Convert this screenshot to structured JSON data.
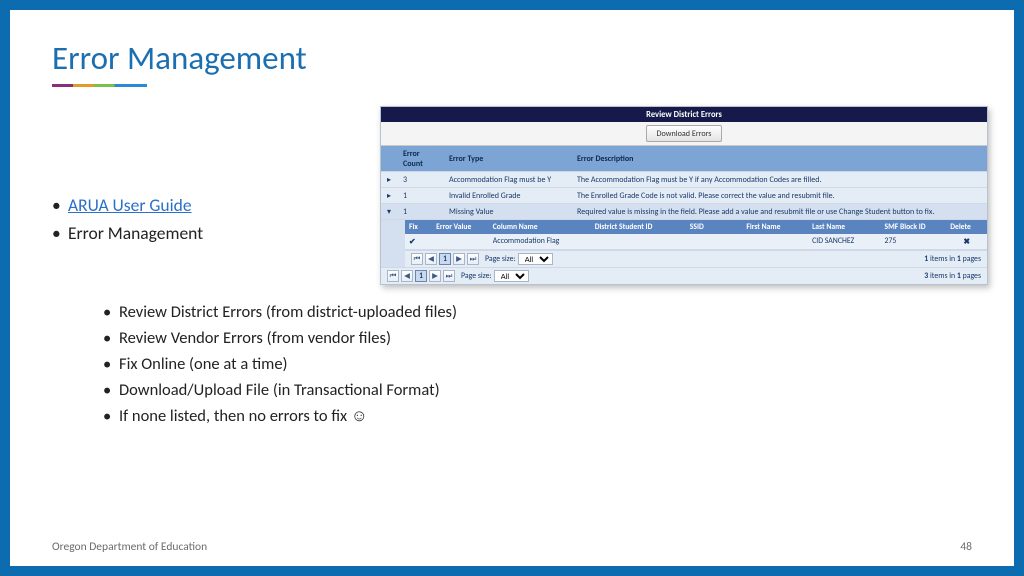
{
  "title": "Error Management",
  "bullets": {
    "link_text": "ARUA User Guide",
    "item2": "Error Management",
    "subs": [
      "Review District Errors (from district-uploaded files)",
      "Review Vendor Errors (from vendor files)",
      "Fix Online (one at a time)",
      "Download/Upload File (in Transactional Format)",
      "If none listed, then no errors to fix ☺"
    ]
  },
  "panel": {
    "title": "Review District Errors",
    "download_btn": "Download Errors",
    "cols": {
      "c0": "",
      "c1": "Error Count",
      "c2": "Error Type",
      "c3": "Error Description"
    },
    "rows": [
      {
        "exp": "▸",
        "count": "3",
        "type": "Accommodation Flag must be Y",
        "desc": "The Accommodation Flag must be Y if any Accommodation Codes are filled."
      },
      {
        "exp": "▸",
        "count": "1",
        "type": "Invalid Enrolled Grade",
        "desc": "The Enrolled Grade Code is not valid. Please correct the value and resubmit file."
      },
      {
        "exp": "▾",
        "count": "1",
        "type": "Missing Value",
        "desc": "Required value is missing in the field. Please add a value and resubmit file or use Change Student button to fix."
      }
    ],
    "nested_cols": {
      "fix": "Fix",
      "err": "Error Value",
      "col": "Column Name",
      "dsid": "District Student ID",
      "ssid": "SSID",
      "fn": "First Name",
      "ln": "Last Name",
      "smf": "SMF Block ID",
      "del": "Delete"
    },
    "nested_row": {
      "fix": "✔",
      "err": "",
      "col": "Accommodation Flag",
      "dsid": "",
      "ssid": "",
      "fn": "",
      "ln": "CID SANCHEZ",
      "smf": "275",
      "del": "✖"
    },
    "inner_pager": {
      "label": "Page size:",
      "val": "All",
      "summary_a": "1",
      "summary_b": "items in",
      "summary_c": "1",
      "summary_d": "pages"
    },
    "outer_pager": {
      "label": "Page size:",
      "val": "All",
      "summary_a": "3",
      "summary_b": "items in",
      "summary_c": "1",
      "summary_d": "pages"
    }
  },
  "footer": {
    "org": "Oregon Department of Education",
    "page": "48"
  }
}
